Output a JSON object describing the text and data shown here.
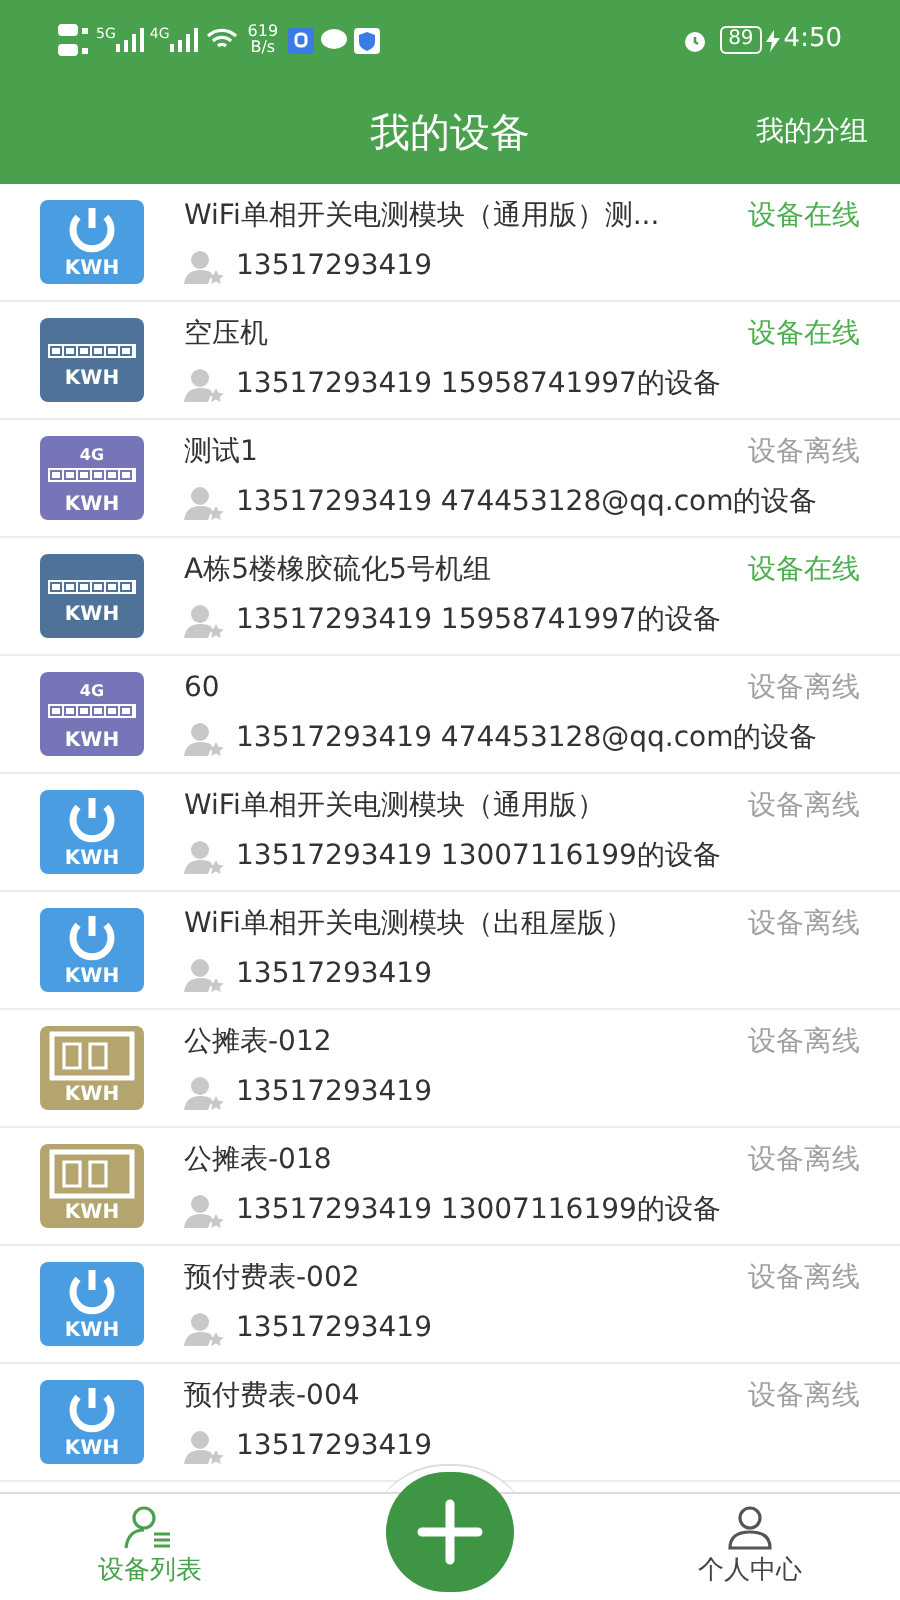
{
  "status_bar": {
    "signal_1": "5G",
    "signal_2": "4G",
    "speed_value": "619",
    "speed_unit": "B/s",
    "battery": "89",
    "time": "4:50"
  },
  "header": {
    "title": "我的设备",
    "action": "我的分组"
  },
  "devices": [
    {
      "name": "WiFi单相开关电测模块（通用版）测...",
      "owner": "13517293419",
      "online": true,
      "status": "设备在线",
      "icon": {
        "kind": "power",
        "label": "KWH"
      }
    },
    {
      "name": "空压机",
      "owner": "13517293419 15958741997的设备",
      "online": true,
      "status": "设备在线",
      "icon": {
        "kind": "meter",
        "label": "KWH"
      }
    },
    {
      "name": "测试1",
      "owner": "13517293419 474453128@qq.com的设备",
      "online": false,
      "status": "设备离线",
      "icon": {
        "kind": "meter4g",
        "label": "KWH",
        "badge": "4G"
      }
    },
    {
      "name": "A栋5楼橡胶硫化5号机组",
      "owner": "13517293419 15958741997的设备",
      "online": true,
      "status": "设备在线",
      "icon": {
        "kind": "meter",
        "label": "KWH"
      }
    },
    {
      "name": "60",
      "owner": "13517293419 474453128@qq.com的设备",
      "online": false,
      "status": "设备离线",
      "icon": {
        "kind": "meter4g",
        "label": "KWH",
        "badge": "4G"
      }
    },
    {
      "name": "WiFi单相开关电测模块（通用版）",
      "owner": "13517293419 13007116199的设备",
      "online": false,
      "status": "设备离线",
      "icon": {
        "kind": "power",
        "label": "KWH"
      }
    },
    {
      "name": "WiFi单相开关电测模块（出租屋版）",
      "owner": "13517293419",
      "online": false,
      "status": "设备离线",
      "icon": {
        "kind": "power",
        "label": "KWH"
      }
    },
    {
      "name": "公摊表-012",
      "owner": "13517293419",
      "online": false,
      "status": "设备离线",
      "icon": {
        "kind": "digit",
        "label": "KWH"
      }
    },
    {
      "name": "公摊表-018",
      "owner": "13517293419 13007116199的设备",
      "online": false,
      "status": "设备离线",
      "icon": {
        "kind": "digit",
        "label": "KWH"
      }
    },
    {
      "name": "预付费表-002",
      "owner": "13517293419",
      "online": false,
      "status": "设备离线",
      "icon": {
        "kind": "power",
        "label": "KWH"
      }
    },
    {
      "name": "预付费表-004",
      "owner": "13517293419",
      "online": false,
      "status": "设备离线",
      "icon": {
        "kind": "power",
        "label": "KWH"
      }
    }
  ],
  "bottom_nav": [
    {
      "label": "设备列表",
      "selected": true,
      "kind": "list"
    },
    {
      "label": "个人中心",
      "selected": false,
      "kind": "person"
    }
  ]
}
